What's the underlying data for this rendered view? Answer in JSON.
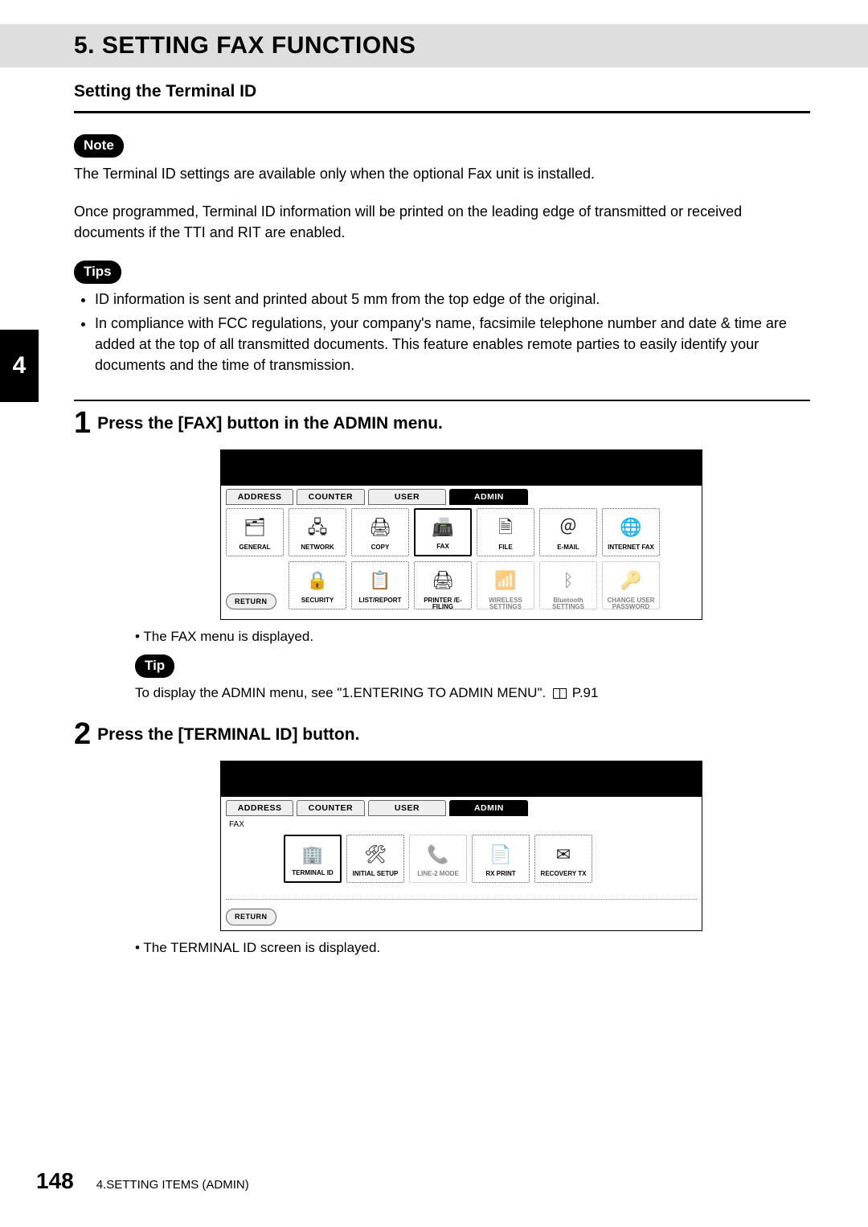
{
  "header": {
    "title": "5. SETTING FAX FUNCTIONS"
  },
  "subhead": "Setting the Terminal ID",
  "sideTab": "4",
  "note": {
    "label": "Note",
    "text": "The Terminal ID settings are available only when the optional Fax unit is installed."
  },
  "para2": "Once programmed, Terminal ID information will be printed on the leading edge of transmitted or received documents if the TTI and RIT are enabled.",
  "tips": {
    "label": "Tips",
    "items": [
      "ID information is sent and printed about 5 mm from the top edge of the original.",
      "In compliance with FCC regulations, your company's name, facsimile telephone number and date & time are added at the top of all transmitted documents.  This feature enables remote parties to easily identify your documents and the time of transmission."
    ]
  },
  "step1": {
    "num": "1",
    "title": "Press the [FAX] button in the ADMIN menu.",
    "afterBullet": "The FAX menu is displayed.",
    "tipLabel": "Tip",
    "tipText": "To display the ADMIN menu, see \"1.ENTERING TO ADMIN MENU\".",
    "pageRef": "P.91"
  },
  "step2": {
    "num": "2",
    "title": "Press the [TERMINAL ID] button.",
    "breadcrumb": "FAX",
    "afterBullet": "The TERMINAL ID screen is displayed."
  },
  "tabs": {
    "address": "ADDRESS",
    "counter": "COUNTER",
    "user": "USER",
    "admin": "ADMIN"
  },
  "adminButtons": {
    "row1": {
      "general": "GENERAL",
      "network": "NETWORK",
      "copy": "COPY",
      "fax": "FAX",
      "file": "FILE",
      "email": "E-MAIL",
      "ifax": "INTERNET FAX"
    },
    "row2": {
      "return": "RETURN",
      "security": "SECURITY",
      "listreport": "LIST/REPORT",
      "printer": "PRINTER /E-FILING",
      "wireless": "WIRELESS SETTINGS",
      "bluetooth": "Bluetooth SETTINGS",
      "changepw": "CHANGE USER PASSWORD"
    }
  },
  "faxButtons": {
    "terminalId": "TERMINAL ID",
    "initialSetup": "INITIAL SETUP",
    "line2mode": "LINE-2 MODE",
    "rxPrint": "RX PRINT",
    "recoveryTx": "RECOVERY TX",
    "return": "RETURN"
  },
  "pageFooter": {
    "pageNum": "148",
    "chapter": "4.SETTING ITEMS (ADMIN)"
  }
}
